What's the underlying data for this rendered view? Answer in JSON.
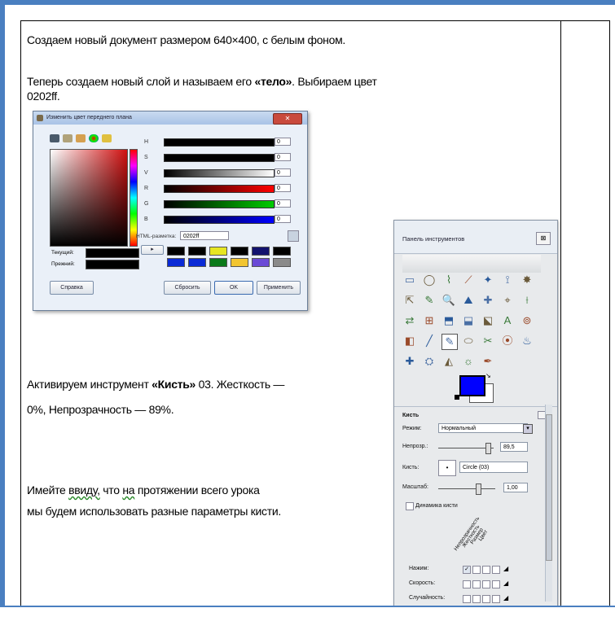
{
  "doc": {
    "line1": "Создаем новый документ размером 640×400,  с белым фоном.",
    "line2_pre": "Теперь создаем новый слой и называем  его ",
    "line2_bold": "«тело»",
    "line2_post": ". Выбираем цвет",
    "line3": "0202ff.",
    "brush_pre": "Активируем инструмент  ",
    "brush_bold": "«Кисть»",
    "brush_post": " 03. Жесткость —",
    "brush_line2": "0%, Непрозрачность  — 89%.",
    "note_a": "Имейте ",
    "note_wavy1": "ввиду,",
    "note_b": " что ",
    "note_wavy2": "на",
    "note_c": " протяжении  всего урока",
    "note_line2": "мы будем использовать  разные параметры  кисти."
  },
  "color_dialog": {
    "title": "Изменить цвет переднего плана",
    "close_glyph": "✕",
    "channel_labels": [
      "H",
      "S",
      "V",
      "R",
      "G",
      "B"
    ],
    "channel_values": [
      "0",
      "0",
      "0",
      "0",
      "0",
      "0"
    ],
    "html_label": "HTML-разметка:",
    "html_value": "0202ff",
    "current_label": "Текущий:",
    "previous_label": "Прежний:",
    "btn_help": "Справка",
    "btn_reset": "Сбросить",
    "btn_ok": "OK",
    "btn_apply": "Применить",
    "colors": {
      "swatch_row1": [
        "#000000",
        "#000000",
        "#e6e622",
        "#000000",
        "#12126e",
        "#000000"
      ],
      "swatch_row2": [
        "#0a2ad6",
        "#0a2ad6",
        "#0a7a1a",
        "#f2c530",
        "#6a4ad6",
        "#8a8a8a"
      ]
    }
  },
  "toolbox": {
    "title": "Панель инструментов",
    "close_glyph": "⊠",
    "brush_section": "Кисть",
    "mode_label": "Режим:",
    "mode_value": "Нормальный",
    "opacity_label": "Непрозр.:",
    "opacity_value": "89,5",
    "brush_label": "Кисть:",
    "brush_value": "Circle (03)",
    "scale_label": "Масштаб:",
    "scale_value": "1,00",
    "dynamics_label": "Динамика кисти",
    "diag_labels": [
      "Непрозрачность",
      "Жесткость",
      "Размер",
      "Цвет"
    ],
    "pressure_label": "Нажим:",
    "speed_label": "Скорость:",
    "random_label": "Случайность:",
    "fg_color": "#0000ff"
  }
}
